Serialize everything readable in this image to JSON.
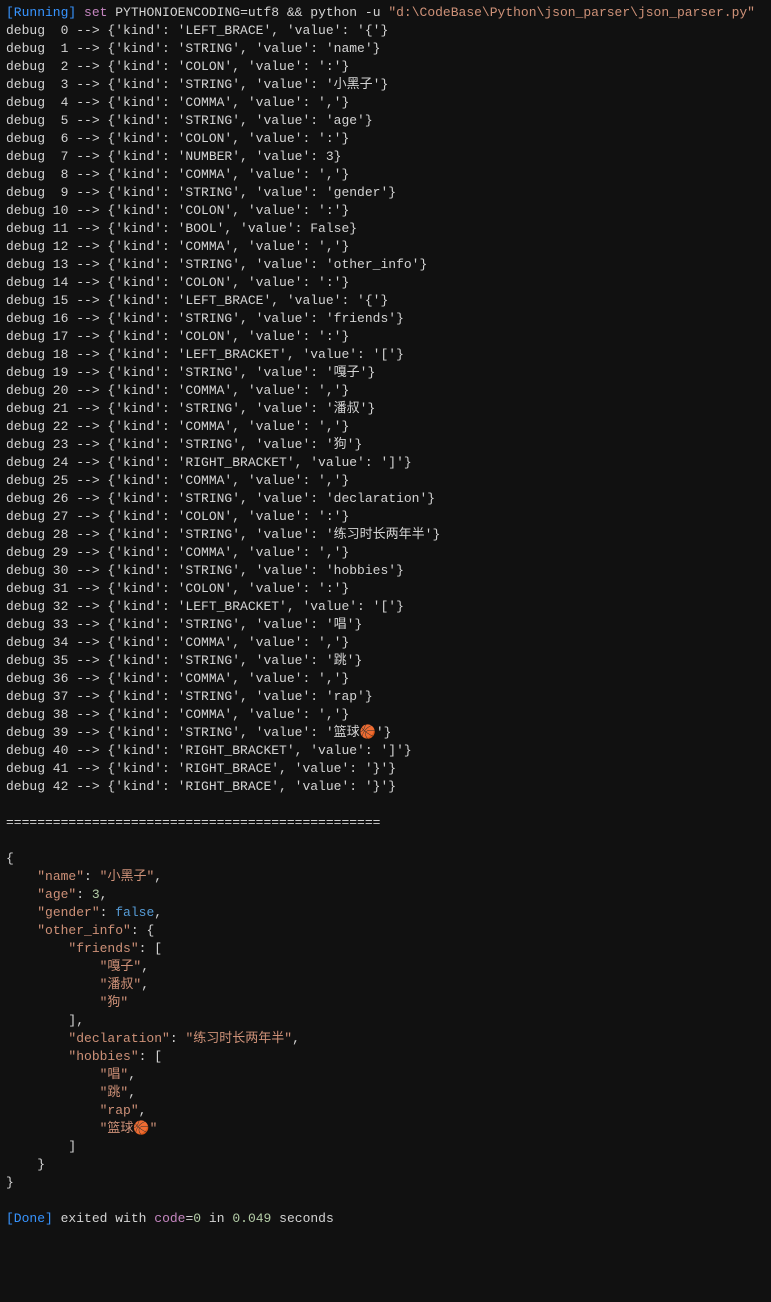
{
  "header": {
    "running_tag": "[Running]",
    "cmd_set": "set",
    "cmd_env": "PYTHONIOENCODING=utf8 && python -u",
    "cmd_path": "\"d:\\CodeBase\\Python\\json_parser\\json_parser.py\""
  },
  "debug_lines": [
    "debug  0 --> {'kind': 'LEFT_BRACE', 'value': '{'}",
    "debug  1 --> {'kind': 'STRING', 'value': 'name'}",
    "debug  2 --> {'kind': 'COLON', 'value': ':'}",
    "debug  3 --> {'kind': 'STRING', 'value': '小黑子'}",
    "debug  4 --> {'kind': 'COMMA', 'value': ','}",
    "debug  5 --> {'kind': 'STRING', 'value': 'age'}",
    "debug  6 --> {'kind': 'COLON', 'value': ':'}",
    "debug  7 --> {'kind': 'NUMBER', 'value': 3}",
    "debug  8 --> {'kind': 'COMMA', 'value': ','}",
    "debug  9 --> {'kind': 'STRING', 'value': 'gender'}",
    "debug 10 --> {'kind': 'COLON', 'value': ':'}",
    "debug 11 --> {'kind': 'BOOL', 'value': False}",
    "debug 12 --> {'kind': 'COMMA', 'value': ','}",
    "debug 13 --> {'kind': 'STRING', 'value': 'other_info'}",
    "debug 14 --> {'kind': 'COLON', 'value': ':'}",
    "debug 15 --> {'kind': 'LEFT_BRACE', 'value': '{'}",
    "debug 16 --> {'kind': 'STRING', 'value': 'friends'}",
    "debug 17 --> {'kind': 'COLON', 'value': ':'}",
    "debug 18 --> {'kind': 'LEFT_BRACKET', 'value': '['}",
    "debug 19 --> {'kind': 'STRING', 'value': '嘎子'}",
    "debug 20 --> {'kind': 'COMMA', 'value': ','}",
    "debug 21 --> {'kind': 'STRING', 'value': '潘叔'}",
    "debug 22 --> {'kind': 'COMMA', 'value': ','}",
    "debug 23 --> {'kind': 'STRING', 'value': '狗'}",
    "debug 24 --> {'kind': 'RIGHT_BRACKET', 'value': ']'}",
    "debug 25 --> {'kind': 'COMMA', 'value': ','}",
    "debug 26 --> {'kind': 'STRING', 'value': 'declaration'}",
    "debug 27 --> {'kind': 'COLON', 'value': ':'}",
    "debug 28 --> {'kind': 'STRING', 'value': '练习时长两年半'}",
    "debug 29 --> {'kind': 'COMMA', 'value': ','}",
    "debug 30 --> {'kind': 'STRING', 'value': 'hobbies'}",
    "debug 31 --> {'kind': 'COLON', 'value': ':'}",
    "debug 32 --> {'kind': 'LEFT_BRACKET', 'value': '['}",
    "debug 33 --> {'kind': 'STRING', 'value': '唱'}",
    "debug 34 --> {'kind': 'COMMA', 'value': ','}",
    "debug 35 --> {'kind': 'STRING', 'value': '跳'}",
    "debug 36 --> {'kind': 'COMMA', 'value': ','}",
    "debug 37 --> {'kind': 'STRING', 'value': 'rap'}",
    "debug 38 --> {'kind': 'COMMA', 'value': ','}",
    "debug 39 --> {'kind': 'STRING', 'value': '篮球🏀'}",
    "debug 40 --> {'kind': 'RIGHT_BRACKET', 'value': ']'}",
    "debug 41 --> {'kind': 'RIGHT_BRACE', 'value': '}'}",
    "debug 42 --> {'kind': 'RIGHT_BRACE', 'value': '}'}"
  ],
  "separator": "================================================",
  "json_output": [
    {
      "indent": 0,
      "tokens": [
        {
          "t": "punct",
          "v": "{"
        }
      ]
    },
    {
      "indent": 1,
      "tokens": [
        {
          "t": "key",
          "v": "\"name\""
        },
        {
          "t": "punct",
          "v": ": "
        },
        {
          "t": "str",
          "v": "\"小黑子\""
        },
        {
          "t": "punct",
          "v": ","
        }
      ]
    },
    {
      "indent": 1,
      "tokens": [
        {
          "t": "key",
          "v": "\"age\""
        },
        {
          "t": "punct",
          "v": ": "
        },
        {
          "t": "num",
          "v": "3"
        },
        {
          "t": "punct",
          "v": ","
        }
      ]
    },
    {
      "indent": 1,
      "tokens": [
        {
          "t": "key",
          "v": "\"gender\""
        },
        {
          "t": "punct",
          "v": ": "
        },
        {
          "t": "bool",
          "v": "false"
        },
        {
          "t": "punct",
          "v": ","
        }
      ]
    },
    {
      "indent": 1,
      "tokens": [
        {
          "t": "key",
          "v": "\"other_info\""
        },
        {
          "t": "punct",
          "v": ": {"
        }
      ]
    },
    {
      "indent": 2,
      "tokens": [
        {
          "t": "key",
          "v": "\"friends\""
        },
        {
          "t": "punct",
          "v": ": ["
        }
      ]
    },
    {
      "indent": 3,
      "tokens": [
        {
          "t": "str",
          "v": "\"嘎子\""
        },
        {
          "t": "punct",
          "v": ","
        }
      ]
    },
    {
      "indent": 3,
      "tokens": [
        {
          "t": "str",
          "v": "\"潘叔\""
        },
        {
          "t": "punct",
          "v": ","
        }
      ]
    },
    {
      "indent": 3,
      "tokens": [
        {
          "t": "str",
          "v": "\"狗\""
        }
      ]
    },
    {
      "indent": 2,
      "tokens": [
        {
          "t": "punct",
          "v": "],"
        }
      ]
    },
    {
      "indent": 2,
      "tokens": [
        {
          "t": "key",
          "v": "\"declaration\""
        },
        {
          "t": "punct",
          "v": ": "
        },
        {
          "t": "str",
          "v": "\"练习时长两年半\""
        },
        {
          "t": "punct",
          "v": ","
        }
      ]
    },
    {
      "indent": 2,
      "tokens": [
        {
          "t": "key",
          "v": "\"hobbies\""
        },
        {
          "t": "punct",
          "v": ": ["
        }
      ]
    },
    {
      "indent": 3,
      "tokens": [
        {
          "t": "str",
          "v": "\"唱\""
        },
        {
          "t": "punct",
          "v": ","
        }
      ]
    },
    {
      "indent": 3,
      "tokens": [
        {
          "t": "str",
          "v": "\"跳\""
        },
        {
          "t": "punct",
          "v": ","
        }
      ]
    },
    {
      "indent": 3,
      "tokens": [
        {
          "t": "str",
          "v": "\"rap\""
        },
        {
          "t": "punct",
          "v": ","
        }
      ]
    },
    {
      "indent": 3,
      "tokens": [
        {
          "t": "str",
          "v": "\"篮球🏀\""
        }
      ]
    },
    {
      "indent": 2,
      "tokens": [
        {
          "t": "punct",
          "v": "]"
        }
      ]
    },
    {
      "indent": 1,
      "tokens": [
        {
          "t": "punct",
          "v": "}"
        }
      ]
    },
    {
      "indent": 0,
      "tokens": [
        {
          "t": "punct",
          "v": "}"
        }
      ]
    }
  ],
  "footer": {
    "done_tag": "[Done]",
    "exited_text": "exited with",
    "code_word": "code",
    "eq": "=",
    "code_val": "0",
    "in_word": "in",
    "time_val": "0.049",
    "seconds": "seconds"
  }
}
